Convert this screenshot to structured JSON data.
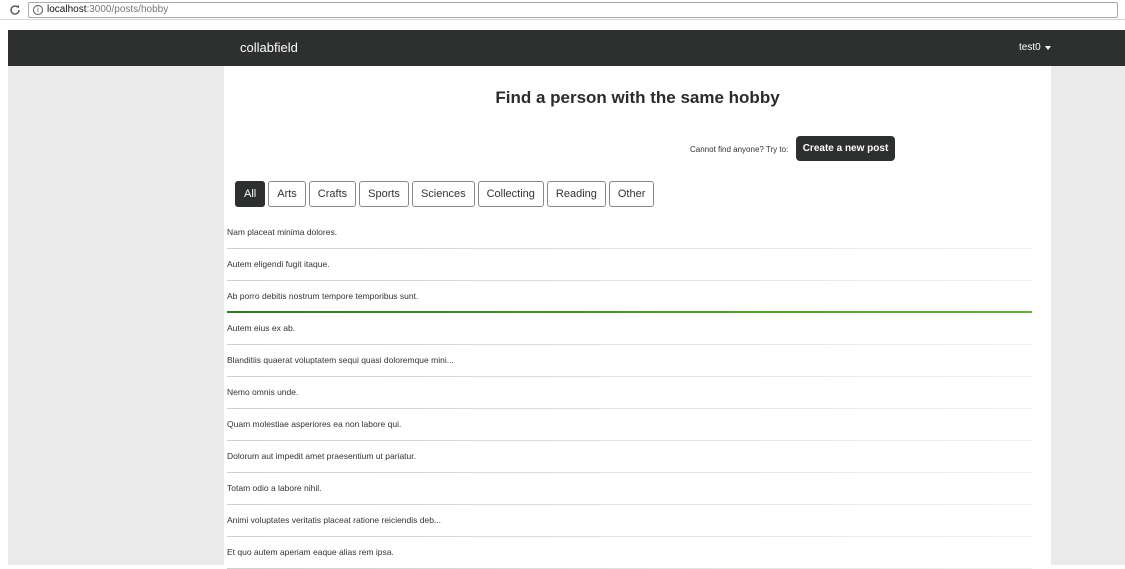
{
  "browser": {
    "url_host": "localhost",
    "url_path": ":3000/posts/hobby"
  },
  "navbar": {
    "brand": "collabfield",
    "user": "test0"
  },
  "main": {
    "title": "Find a person with the same hobby",
    "cta_text": "Cannot find anyone? Try to:",
    "cta_button": "Create a new post",
    "tabs": [
      "All",
      "Arts",
      "Crafts",
      "Sports",
      "Sciences",
      "Collecting",
      "Reading",
      "Other"
    ],
    "active_tab": "All",
    "posts": [
      "Nam placeat minima dolores.",
      "Autem eligendi fugit itaque.",
      "Ab porro debitis nostrum tempore temporibus sunt.",
      "Autem eius ex ab.",
      "Blanditiis quaerat voluptatem sequi quasi doloremque mini...",
      "Nemo omnis unde.",
      "Quam molestiae asperiores ea non labore qui.",
      "Dolorum aut impedit amet praesentium ut pariatur.",
      "Totam odio a labore nihil.",
      "Animi voluptates veritatis placeat ratione reiciendis deb...",
      "Et quo autem aperiam eaque alias rem ipsa."
    ]
  },
  "colors": {
    "navbar": "#2e3030",
    "page_background": "#ebebeb",
    "highlight_line": "#2f7a1f"
  },
  "icons": [
    "reload-icon",
    "info-icon",
    "caret-down-icon"
  ]
}
